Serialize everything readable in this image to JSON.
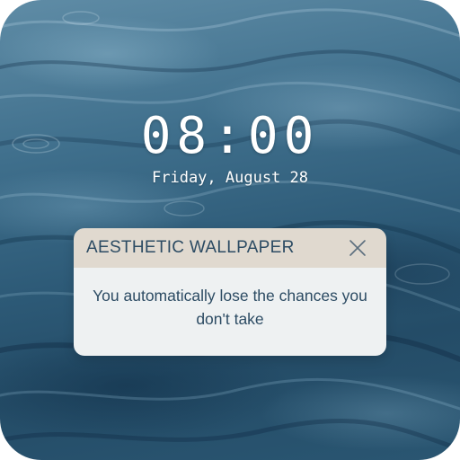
{
  "lockscreen": {
    "time": "08:00",
    "date": "Friday, August 28"
  },
  "notification": {
    "title": "AESTHETIC WALLPAPER",
    "message": "You automatically lose the chances you don't take",
    "close_icon": "close-icon"
  },
  "colors": {
    "notification_header": "#e0d9cf",
    "notification_body": "#eef1f2",
    "notification_text": "#2c4b63",
    "clock_text": "#ffffff",
    "water_dark": "#244c67",
    "water_light": "#5f8ca6"
  }
}
